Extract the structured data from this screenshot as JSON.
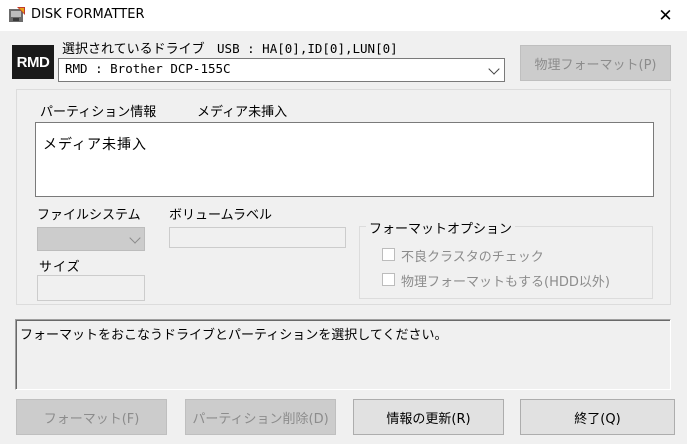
{
  "window": {
    "title": "DISK FORMATTER",
    "close_glyph": "✕"
  },
  "drive": {
    "logo_text": "RMD",
    "label_jp": "選択されているドライブ",
    "label_info": "USB : HA[0],ID[0],LUN[0]",
    "selected": "RMD : Brother DCP-155C",
    "physical_format_button": "物理フォーマット(P)"
  },
  "partition": {
    "info_label": "パーティション情報",
    "media_status_label": "メディア未挿入",
    "media_text": "メディア未挿入"
  },
  "fields": {
    "filesystem_label": "ファイルシステム",
    "volume_label_label": "ボリュームラベル",
    "size_label": "サイズ",
    "volume_label_value": "",
    "size_value": ""
  },
  "format_options": {
    "group_label": "フォーマットオプション",
    "bad_cluster_check": "不良クラスタのチェック",
    "physical_format_hdd": "物理フォーマットもする(HDD以外)"
  },
  "status": {
    "message": "フォーマットをおこなうドライブとパーティションを選択してください。"
  },
  "buttons": {
    "format": "フォーマット(F)",
    "delete_partition": "パーティション削除(D)",
    "refresh": "情報の更新(R)",
    "exit": "終了(Q)"
  },
  "icons": {
    "app": "disk-formatter-app-icon",
    "close": "close-icon",
    "chevron": "chevron-down-icon"
  }
}
